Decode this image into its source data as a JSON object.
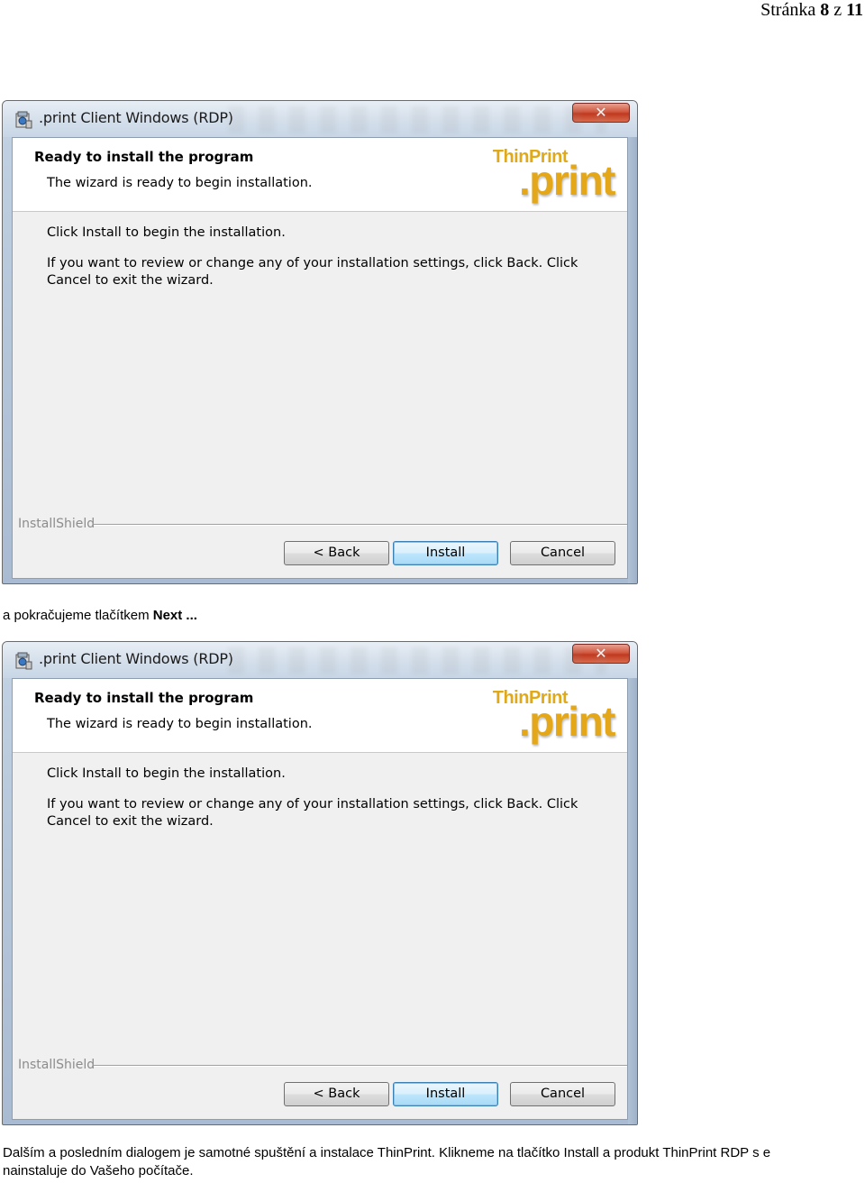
{
  "page": {
    "label_prefix": "Stránka",
    "current": "8",
    "label_mid": "z",
    "total": "11"
  },
  "caption_1": {
    "text": "a pokračujeme tlačítkem",
    "bold": "Next ..."
  },
  "caption_2": {
    "line1": "Dalším a posledním dialogem je samotné spuštění a instalace ThinPrint. Klikneme na tlačítko Install a produkt ThinPrint RDP s e",
    "line2": "nainstaluje do Vašeho počítače."
  },
  "dialogs": [
    {
      "title": ".print Client Windows (RDP)",
      "close_label": "✕",
      "header_title": "Ready to install the program",
      "header_subtitle": "The wizard is ready to begin installation.",
      "logo_brand": "ThinPrint",
      "logo_word": ".print",
      "body_line_1": "Click Install to begin the installation.",
      "body_line_2": "If you want to review or change any of your installation settings, click Back. Click Cancel to exit the wizard.",
      "footer_label": "InstallShield",
      "back_label": "< Back",
      "install_label": "Install",
      "cancel_label": "Cancel"
    },
    {
      "title": ".print Client Windows (RDP)",
      "close_label": "✕",
      "header_title": "Ready to install the program",
      "header_subtitle": "The wizard is ready to begin installation.",
      "logo_brand": "ThinPrint",
      "logo_word": ".print",
      "body_line_1": "Click Install to begin the installation.",
      "body_line_2": "If you want to review or change any of your installation settings, click Back. Click Cancel to exit the wizard.",
      "footer_label": "InstallShield",
      "back_label": "< Back",
      "install_label": "Install",
      "cancel_label": "Cancel"
    }
  ],
  "icons": {
    "app": "installer-package-icon",
    "close": "close-icon"
  },
  "colors": {
    "logo_accent": "#e3a719",
    "install_button_border": "#3c7fb1",
    "close_button": "#c0391f"
  }
}
